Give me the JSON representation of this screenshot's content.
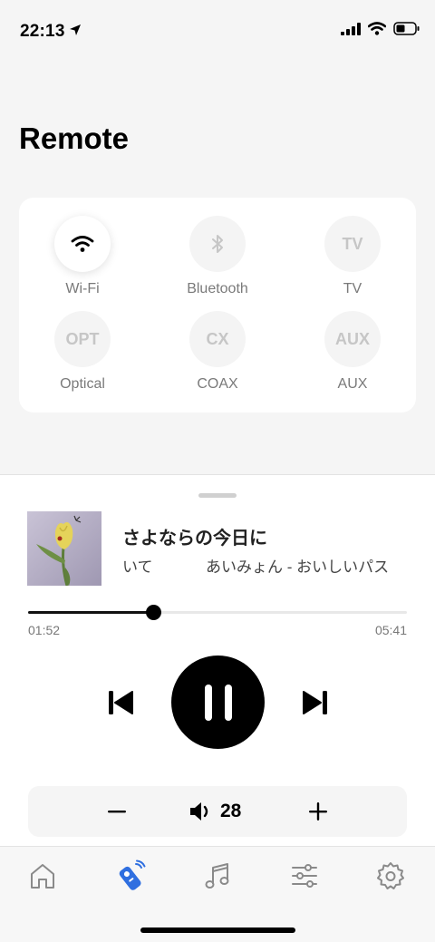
{
  "status_bar": {
    "time": "22:13"
  },
  "page": {
    "title": "Remote"
  },
  "sources": [
    {
      "label": "Wi-Fi",
      "icon": "wifi-icon",
      "active": true
    },
    {
      "label": "Bluetooth",
      "icon": "bluetooth-icon",
      "active": false
    },
    {
      "label": "TV",
      "icon_text": "TV",
      "active": false
    },
    {
      "label": "Optical",
      "icon_text": "OPT",
      "active": false
    },
    {
      "label": "COAX",
      "icon_text": "CX",
      "active": false
    },
    {
      "label": "AUX",
      "icon_text": "AUX",
      "active": false
    }
  ],
  "now_playing": {
    "title": "さよならの今日に",
    "subtitle_left": "いて",
    "subtitle_right": "あいみょん - おいしいパス",
    "elapsed": "01:52",
    "total": "05:41",
    "progress": 0.33
  },
  "volume": {
    "value": "28"
  },
  "tabs": [
    {
      "icon": "home-icon",
      "active": false
    },
    {
      "icon": "remote-icon",
      "active": true
    },
    {
      "icon": "music-note-icon",
      "active": false
    },
    {
      "icon": "equalizer-icon",
      "active": false
    },
    {
      "icon": "settings-gear-icon",
      "active": false
    }
  ],
  "colors": {
    "accent": "#2f6fe0",
    "inactive": "#8a8a8a",
    "background": "#f5f5f5"
  }
}
